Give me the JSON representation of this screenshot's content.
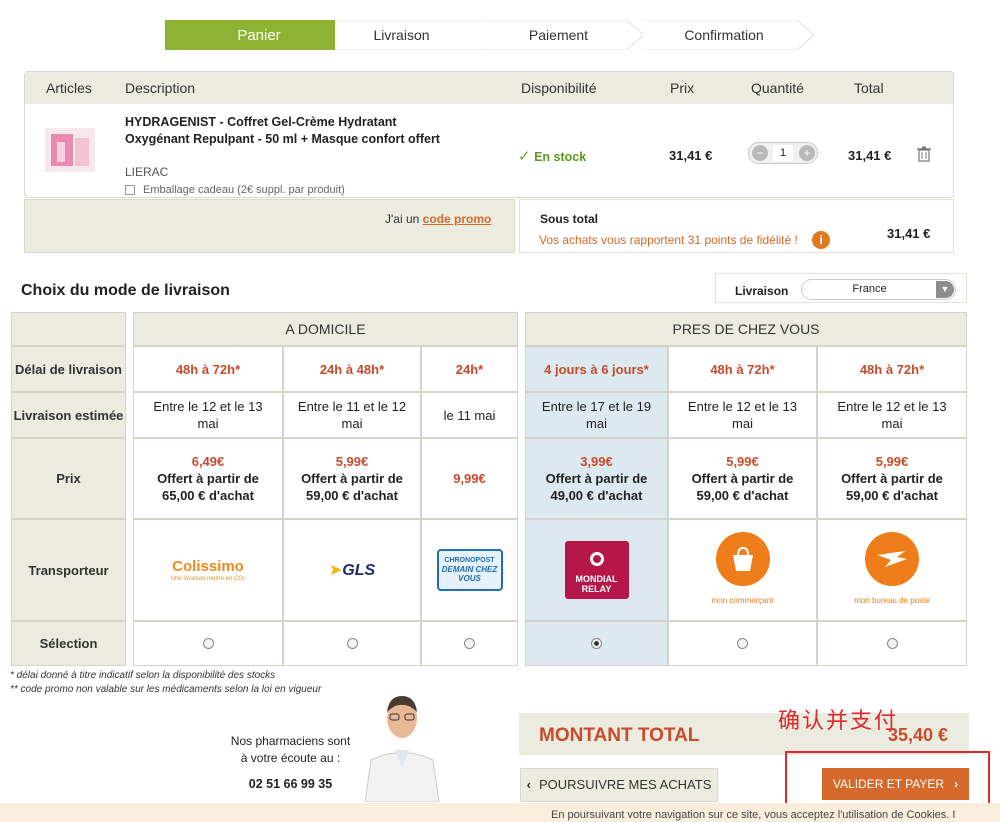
{
  "steps": [
    "Panier",
    "Livraison",
    "Paiement",
    "Confirmation"
  ],
  "cart": {
    "headers": [
      "Articles",
      "Description",
      "Disponibilité",
      "Prix",
      "Quantité",
      "Total"
    ],
    "product": {
      "title": "HYDRAGENIST - Coffret Gel-Crème Hydratant Oxygénant Repulpant - 50 ml + Masque confort offert",
      "brand": "LIERAC",
      "gift_option": "Emballage cadeau (2€ suppl. par produit)",
      "availability": "En stock",
      "price": "31,41 €",
      "quantity": "1",
      "total": "31,41 €"
    },
    "promo_text": "J'ai un",
    "promo_link": "code promo",
    "subtotal_label": "Sous total",
    "fidelity_text": "Vos achats vous rapportent 31 points de fidélité !",
    "subtotal_value": "31,41 €"
  },
  "delivery": {
    "title": "Choix du mode de livraison",
    "country_label": "Livraison",
    "country_value": "France",
    "group_home": "A DOMICILE",
    "group_near": "PRES DE CHEZ VOUS",
    "row_labels": [
      "Délai de livraison",
      "Livraison estimée",
      "Prix",
      "Transporteur",
      "Sélection"
    ],
    "options": [
      {
        "delay": "48h à 72h*",
        "estimate": "Entre le 12 et le 13 mai",
        "price": "6,49€",
        "offer": "Offert à partir de 65,00 € d'achat",
        "carrier": "Colissimo",
        "carrier_sub": "Une livraison neutre en CO₂",
        "selected": false
      },
      {
        "delay": "24h à 48h*",
        "estimate": "Entre le 11 et le 12 mai",
        "price": "5,99€",
        "offer": "Offert à partir de 59,00 € d'achat",
        "carrier": "GLS",
        "carrier_sub": "",
        "selected": false
      },
      {
        "delay": "24h*",
        "estimate": "le 11 mai",
        "price": "9,99€",
        "offer": "",
        "carrier": "CHRONOPOST",
        "carrier_sub": "DEMAIN CHEZ VOUS",
        "selected": false
      },
      {
        "delay": "4 jours à 6 jours*",
        "estimate": "Entre le 17 et le 19 mai",
        "price": "3,99€",
        "offer": "Offert à partir de 49,00 € d'achat",
        "carrier": "MONDIAL RELAY",
        "carrier_sub": "",
        "selected": true
      },
      {
        "delay": "48h à 72h*",
        "estimate": "Entre le 12 et le 13 mai",
        "price": "5,99€",
        "offer": "Offert à partir de 59,00 € d'achat",
        "carrier": "",
        "carrier_sub": "mon commerçant",
        "selected": false
      },
      {
        "delay": "48h à 72h*",
        "estimate": "Entre le 12 et le 13 mai",
        "price": "5,99€",
        "offer": "Offert à partir de 59,00 € d'achat",
        "carrier": "",
        "carrier_sub": "mon bureau de poste",
        "selected": false
      }
    ]
  },
  "notes": [
    "* délai donné à titre indicatif selon la disponibilité des stocks",
    "** code promo non valable sur les médicaments selon la loi en vigueur"
  ],
  "pharmacist": {
    "line1": "Nos pharmaciens sont",
    "line2": "à votre écoute au :",
    "phone": "02 51 66 99 35"
  },
  "total": {
    "label": "MONTANT TOTAL",
    "value": "35,40 €",
    "annotation": "确认并支付"
  },
  "buttons": {
    "continue": "POURSUIVRE MES ACHATS",
    "validate": "VALIDER ET PAYER"
  },
  "cookie_text": "En poursuivant votre navigation sur ce site, vous acceptez l'utilisation de Cookies. I",
  "colors": {
    "accent_green": "#8db234",
    "accent_orange": "#d5692b",
    "price_red": "#c84b2b",
    "annotation_red": "#e0272b"
  }
}
